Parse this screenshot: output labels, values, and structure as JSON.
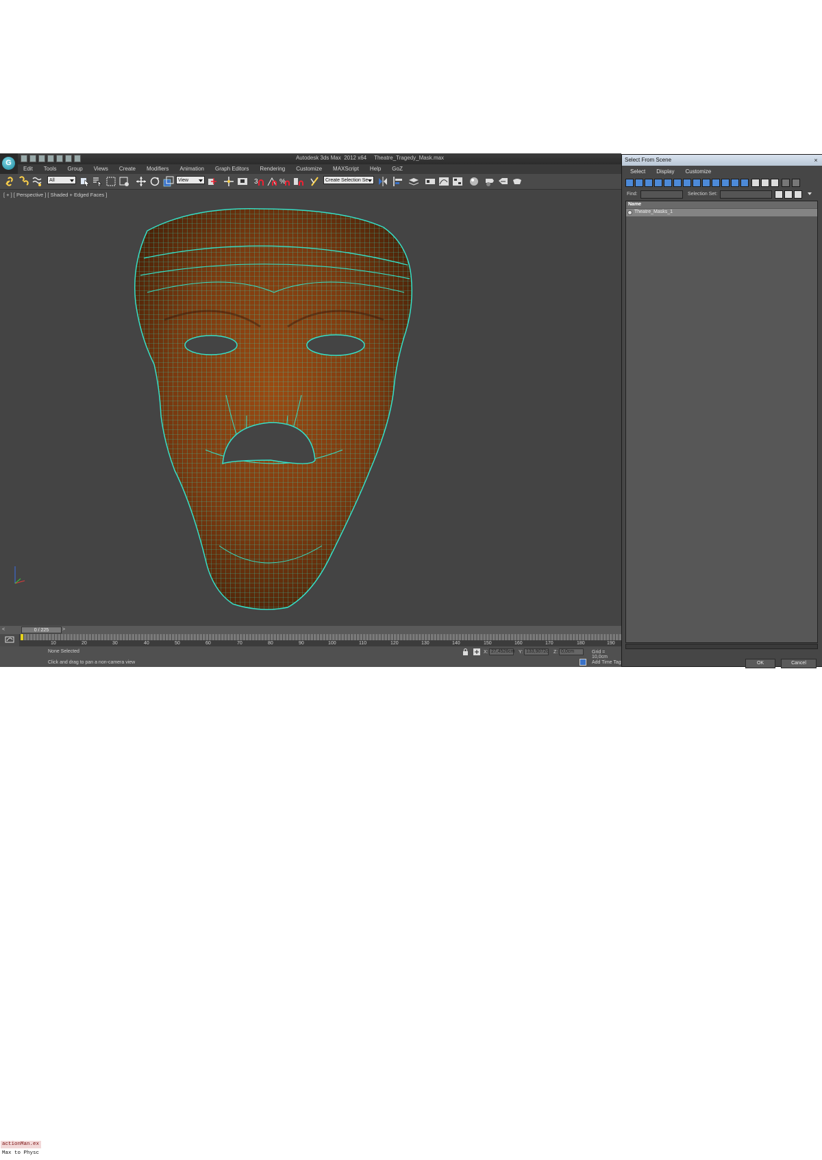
{
  "app": {
    "title": "Autodesk 3ds Max  2012 x64     Theatre_Tragedy_Mask.max",
    "logo_glyph": "G",
    "menu": [
      "Edit",
      "Tools",
      "Group",
      "Views",
      "Create",
      "Modifiers",
      "Animation",
      "Graph Editors",
      "Rendering",
      "Customize",
      "MAXScript",
      "Help",
      "GoZ"
    ]
  },
  "toolbar": {
    "selection_filter": "All",
    "ref_coord": "View",
    "named_selection": "Create Selection Se"
  },
  "viewport": {
    "label": "[ + ] [ Perspective ] [ Shaded + Edged Faces ]",
    "colors": {
      "background": "#444444",
      "wire": "#34e0c8",
      "texture": "#7a3a10"
    }
  },
  "timeline": {
    "slider": "0 / 225",
    "prev": "<",
    "next": ">",
    "ticks": [
      "10",
      "20",
      "30",
      "40",
      "50",
      "60",
      "70",
      "80",
      "90",
      "100",
      "110",
      "120",
      "130",
      "140",
      "150",
      "160",
      "170",
      "180",
      "190"
    ]
  },
  "status": {
    "maxscript_line1": "actionMan.ex",
    "maxscript_line2": "Max to Physc",
    "selection": "None Selected",
    "prompt": "Click and drag to pan a non-camera view",
    "x_label": "X:",
    "x_value": "27,4526cm",
    "y_label": "Y:",
    "y_value": "133,9072c",
    "z_label": "Z:",
    "z_value": "0,0cm",
    "grid": "Grid = 10,0cm",
    "add_time_tag": "Add Time Tag"
  },
  "dialog": {
    "title": "Select From Scene",
    "close": "×",
    "menu": [
      "Select",
      "Display",
      "Customize"
    ],
    "find_label": "Find:",
    "selection_set_label": "Selection Set:",
    "column_header": "Name",
    "items": [
      "Theatre_Masks_1"
    ],
    "ok": "OK",
    "cancel": "Cancel"
  }
}
